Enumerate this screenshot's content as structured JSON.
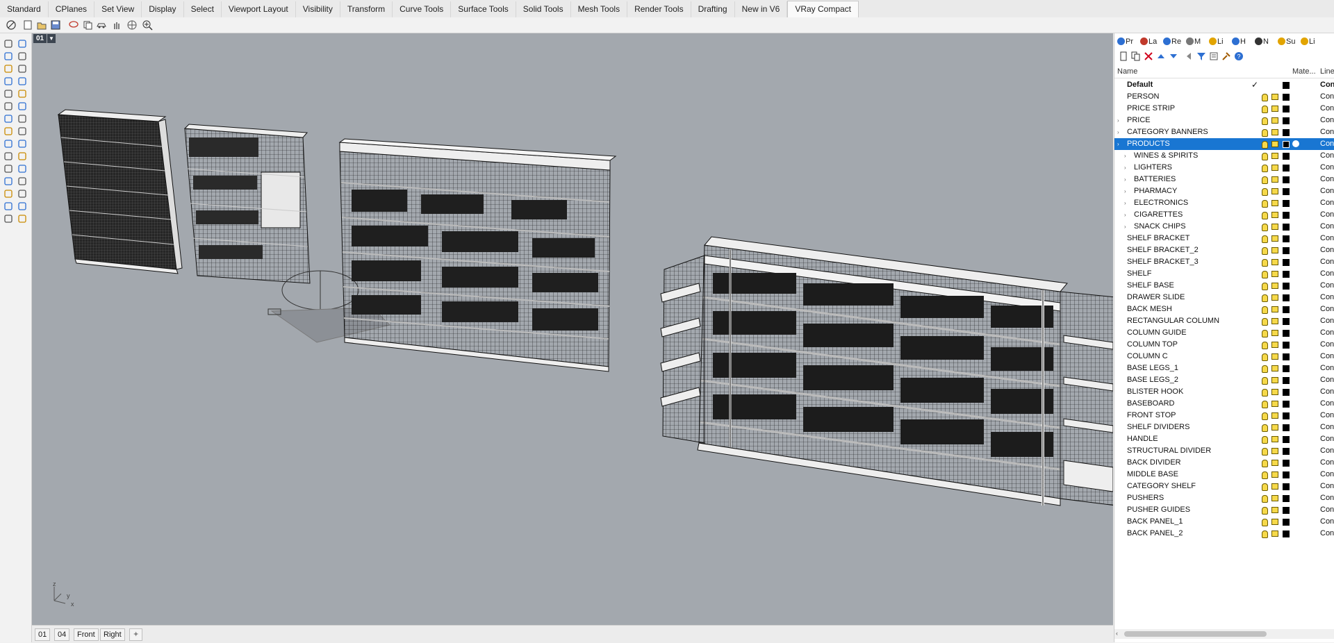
{
  "ribbon_tabs": [
    "Standard",
    "CPlanes",
    "Set View",
    "Display",
    "Select",
    "Viewport Layout",
    "Visibility",
    "Transform",
    "Curve Tools",
    "Surface Tools",
    "Solid Tools",
    "Mesh Tools",
    "Render Tools",
    "Drafting",
    "New in V6",
    "VRay Compact"
  ],
  "active_tab_index": 15,
  "viewport": {
    "label": "01",
    "axis_z": "z",
    "axis_y": "y",
    "axis_x": "x"
  },
  "viewport_tabs": [
    "01",
    "04",
    "Front",
    "Right"
  ],
  "panel": {
    "tabs": [
      "Pr",
      "La",
      "Re",
      "M",
      "Li",
      "H",
      "N",
      "Su",
      "Li"
    ],
    "columns": {
      "name": "Name",
      "material": "Mate...",
      "linetype": "Line"
    },
    "layers": [
      {
        "name": "Default",
        "bold": true,
        "indent": 0,
        "expand": false,
        "check": "✓",
        "linetype": "Con"
      },
      {
        "name": "PERSON",
        "indent": 0,
        "expand": false,
        "linetype": "Con"
      },
      {
        "name": "PRICE STRIP",
        "indent": 0,
        "expand": false,
        "linetype": "Con"
      },
      {
        "name": "PRICE",
        "indent": 0,
        "expand": true,
        "linetype": "Con"
      },
      {
        "name": "CATEGORY BANNERS",
        "indent": 0,
        "expand": true,
        "linetype": "Con"
      },
      {
        "name": "PRODUCTS",
        "indent": 0,
        "expand": true,
        "selected": true,
        "linetype": "Con"
      },
      {
        "name": "WINES & SPIRITS",
        "indent": 1,
        "expand": true,
        "linetype": "Con"
      },
      {
        "name": "LIGHTERS",
        "indent": 1,
        "expand": true,
        "linetype": "Con"
      },
      {
        "name": "BATTERIES",
        "indent": 1,
        "expand": true,
        "linetype": "Con"
      },
      {
        "name": "PHARMACY",
        "indent": 1,
        "expand": true,
        "linetype": "Con"
      },
      {
        "name": "ELECTRONICS",
        "indent": 1,
        "expand": true,
        "linetype": "Con"
      },
      {
        "name": "CIGARETTES",
        "indent": 1,
        "expand": true,
        "linetype": "Con"
      },
      {
        "name": "SNACK CHIPS",
        "indent": 1,
        "expand": true,
        "linetype": "Con"
      },
      {
        "name": "SHELF BRACKET",
        "indent": 0,
        "expand": false,
        "linetype": "Con"
      },
      {
        "name": "SHELF BRACKET_2",
        "indent": 0,
        "expand": false,
        "linetype": "Con"
      },
      {
        "name": "SHELF BRACKET_3",
        "indent": 0,
        "expand": false,
        "linetype": "Con"
      },
      {
        "name": "SHELF",
        "indent": 0,
        "expand": false,
        "linetype": "Con"
      },
      {
        "name": "SHELF BASE",
        "indent": 0,
        "expand": false,
        "linetype": "Con"
      },
      {
        "name": "DRAWER SLIDE",
        "indent": 0,
        "expand": false,
        "linetype": "Con"
      },
      {
        "name": "BACK MESH",
        "indent": 0,
        "expand": false,
        "linetype": "Con"
      },
      {
        "name": "RECTANGULAR COLUMN",
        "indent": 0,
        "expand": false,
        "linetype": "Con"
      },
      {
        "name": "COLUMN GUIDE",
        "indent": 0,
        "expand": false,
        "linetype": "Con"
      },
      {
        "name": "COLUMN TOP",
        "indent": 0,
        "expand": false,
        "linetype": "Con"
      },
      {
        "name": "COLUMN C",
        "indent": 0,
        "expand": false,
        "linetype": "Con"
      },
      {
        "name": "BASE LEGS_1",
        "indent": 0,
        "expand": false,
        "linetype": "Con"
      },
      {
        "name": "BASE LEGS_2",
        "indent": 0,
        "expand": false,
        "linetype": "Con"
      },
      {
        "name": "BLISTER HOOK",
        "indent": 0,
        "expand": false,
        "linetype": "Con"
      },
      {
        "name": "BASEBOARD",
        "indent": 0,
        "expand": false,
        "linetype": "Con"
      },
      {
        "name": "FRONT STOP",
        "indent": 0,
        "expand": false,
        "linetype": "Con"
      },
      {
        "name": "SHELF DIVIDERS",
        "indent": 0,
        "expand": false,
        "linetype": "Con"
      },
      {
        "name": "HANDLE",
        "indent": 0,
        "expand": false,
        "linetype": "Con"
      },
      {
        "name": "STRUCTURAL DIVIDER",
        "indent": 0,
        "expand": false,
        "linetype": "Con"
      },
      {
        "name": "BACK DIVIDER",
        "indent": 0,
        "expand": false,
        "linetype": "Con"
      },
      {
        "name": "MIDDLE BASE",
        "indent": 0,
        "expand": false,
        "linetype": "Con"
      },
      {
        "name": "CATEGORY SHELF",
        "indent": 0,
        "expand": false,
        "linetype": "Con"
      },
      {
        "name": "PUSHERS",
        "indent": 0,
        "expand": false,
        "linetype": "Con"
      },
      {
        "name": "PUSHER GUIDES",
        "indent": 0,
        "expand": false,
        "linetype": "Con"
      },
      {
        "name": "BACK PANEL_1",
        "indent": 0,
        "expand": false,
        "linetype": "Con"
      },
      {
        "name": "BACK PANEL_2",
        "indent": 0,
        "expand": false,
        "linetype": "Con"
      }
    ]
  },
  "colors": {
    "viewport_bg": "#a3a8ae",
    "selection": "#1976d2",
    "layer_color": "#000000"
  }
}
